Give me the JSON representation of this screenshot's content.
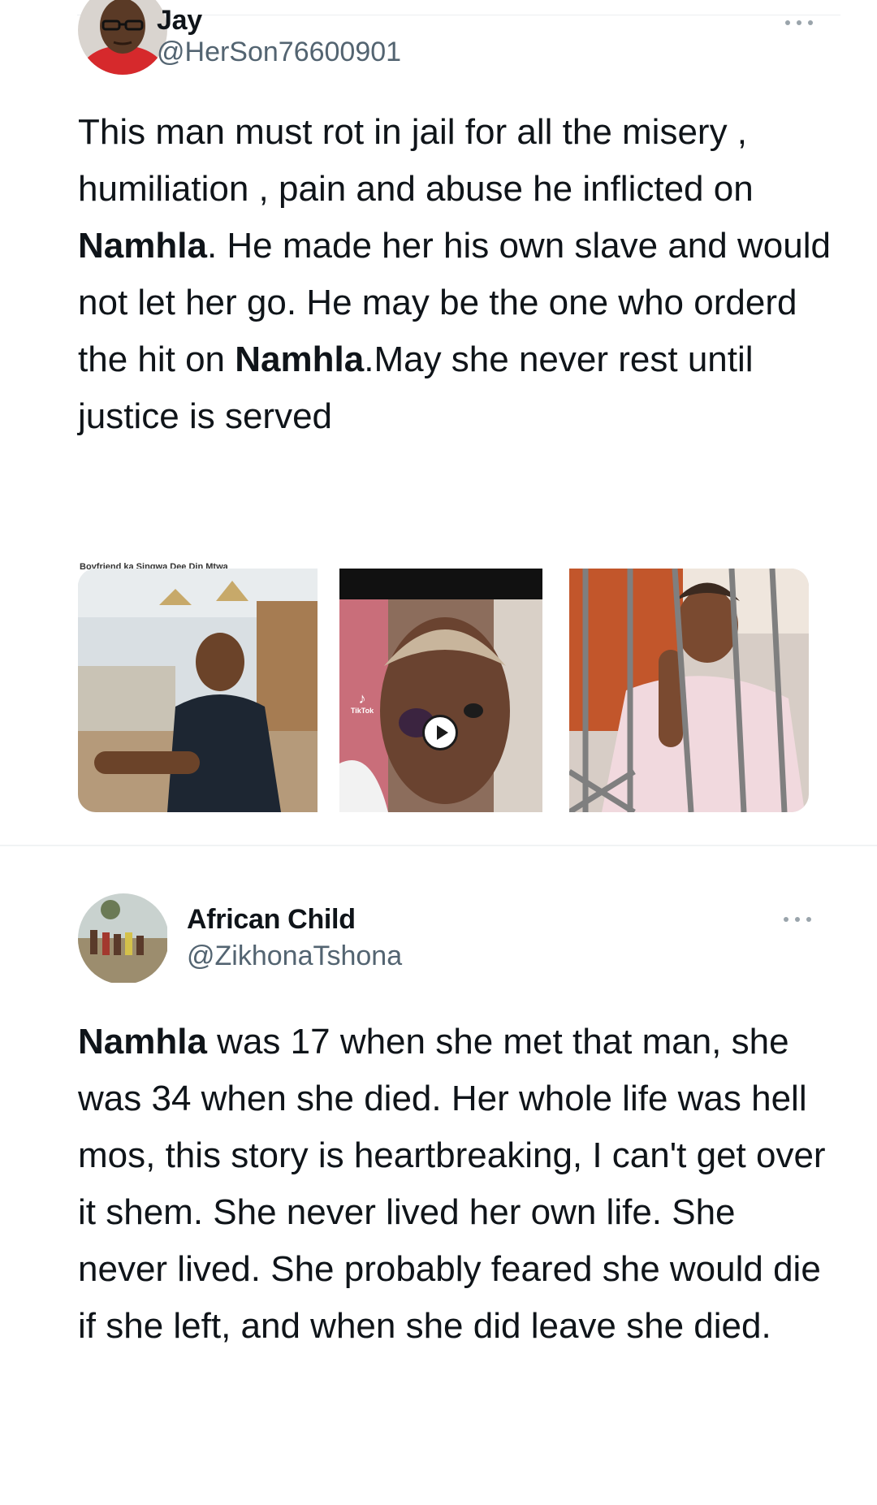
{
  "tweets": [
    {
      "author": {
        "display_name": "Jay",
        "handle": "@HerSon76600901",
        "avatar_icon": "profile-avatar"
      },
      "menu_icon": "more-horizontal-icon",
      "text": {
        "p1": "This man must rot in jail for all the misery , humiliation , pain and abuse he inflicted on ",
        "bold1": "Namhla",
        "p2": ". He made her his own slave and would not let her go. He may be the one who orderd the hit on ",
        "bold2": "Namhla",
        "p3": ".May she never rest until justice is served"
      },
      "media": [
        {
          "type": "photo",
          "caption": "Boyfriend ka Singwa Dee Din Mtwa"
        },
        {
          "type": "video",
          "overlay": "TikTok",
          "play_icon": "play-icon"
        },
        {
          "type": "photo"
        }
      ]
    },
    {
      "author": {
        "display_name": "African Child",
        "handle": "@ZikhonaTshona",
        "avatar_icon": "profile-avatar"
      },
      "menu_icon": "more-horizontal-icon",
      "text": {
        "bold1": "Namhla",
        "p1": " was 17  when she met that man, she was 34 when she died. Her whole life was hell mos, this story is heartbreaking, I can't get over it shem. She never lived her own life. She never lived. She probably feared she would die if she left, and when she did leave she died."
      }
    }
  ],
  "colors": {
    "text_primary": "#0f1419",
    "text_secondary": "#536471",
    "divider": "#f1f3f4"
  }
}
